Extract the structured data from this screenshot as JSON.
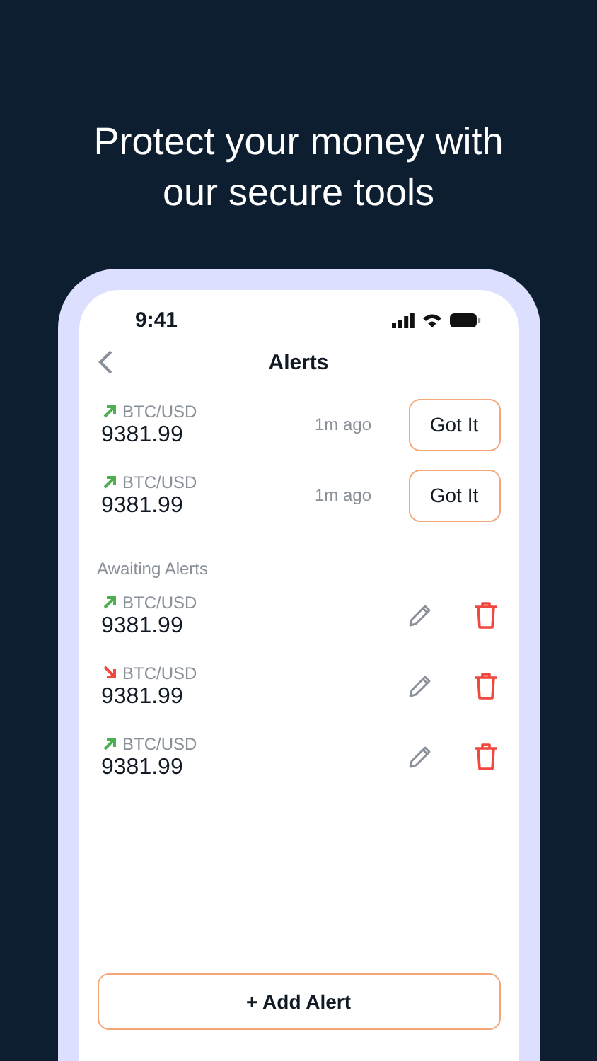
{
  "headline": "Protect your money with our secure tools",
  "status_bar": {
    "time": "9:41"
  },
  "nav": {
    "title": "Alerts"
  },
  "triggered_alerts": [
    {
      "kind": "up",
      "pair": "BTC/USD",
      "price": "9381.99",
      "time": "1m ago",
      "button": "Got It"
    },
    {
      "kind": "up",
      "pair": "BTC/USD",
      "price": "9381.99",
      "time": "1m ago",
      "button": "Got It"
    }
  ],
  "awaiting_title": "Awaiting Alerts",
  "awaiting_alerts": [
    {
      "kind": "up",
      "pair": "BTC/USD",
      "price": "9381.99"
    },
    {
      "kind": "down",
      "pair": "BTC/USD",
      "price": "9381.99"
    },
    {
      "kind": "up",
      "pair": "BTC/USD",
      "price": "9381.99"
    }
  ],
  "add_button": "+ Add Alert"
}
